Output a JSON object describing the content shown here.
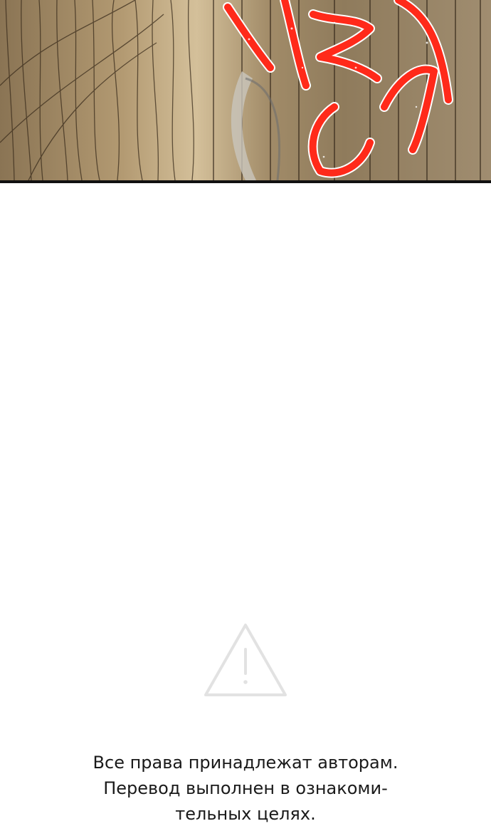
{
  "panel": {
    "description_icon": "comic-panel-image",
    "sfx_color": "#ff2a1a",
    "background_colors": [
      "#8a7454",
      "#d4c09a",
      "#a08d70"
    ]
  },
  "warning": {
    "icon": "warning-triangle-icon",
    "color": "#e2e2e2"
  },
  "notice": {
    "line1": "Все права принадлежат авторам.",
    "line2": "Перевод выполнен в ознакоми-",
    "line3": "тельных целях."
  }
}
